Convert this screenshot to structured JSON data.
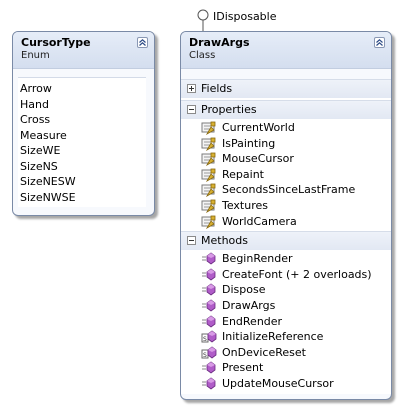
{
  "interface": {
    "label": "IDisposable",
    "icon": "lollipop-interface-icon"
  },
  "enum_shape": {
    "name": "CursorType",
    "kind": "Enum",
    "collapse_icon": "collapse-chevron-icon",
    "members": [
      "Arrow",
      "Hand",
      "Cross",
      "Measure",
      "SizeWE",
      "SizeNS",
      "SizeNESW",
      "SizeNWSE"
    ]
  },
  "class_shape": {
    "name": "DrawArgs",
    "kind": "Class",
    "collapse_icon": "collapse-chevron-icon",
    "sections": {
      "fields": {
        "label": "Fields",
        "expanded": false
      },
      "properties": {
        "label": "Properties",
        "expanded": true,
        "icon": "property-icon",
        "items": [
          "CurrentWorld",
          "IsPainting",
          "MouseCursor",
          "Repaint",
          "SecondsSinceLastFrame",
          "Textures",
          "WorldCamera"
        ]
      },
      "methods": {
        "label": "Methods",
        "expanded": true,
        "items": [
          {
            "label": "BeginRender",
            "icon": "method-icon"
          },
          {
            "label": "CreateFont (+ 2 overloads)",
            "icon": "method-icon"
          },
          {
            "label": "Dispose",
            "icon": "method-icon"
          },
          {
            "label": "DrawArgs",
            "icon": "method-icon"
          },
          {
            "label": "EndRender",
            "icon": "method-icon"
          },
          {
            "label": "InitializeReference",
            "icon": "static-method-icon"
          },
          {
            "label": "OnDeviceReset",
            "icon": "static-method-icon"
          },
          {
            "label": "Present",
            "icon": "method-icon"
          },
          {
            "label": "UpdateMouseCursor",
            "icon": "method-icon"
          }
        ]
      }
    }
  },
  "colors": {
    "header_gradient_top": "#e6edf8",
    "header_gradient_bottom": "#d4deef",
    "border": "#7a8aa6",
    "method_icon": "#b05cc8",
    "property_icon": "#d8b030"
  }
}
